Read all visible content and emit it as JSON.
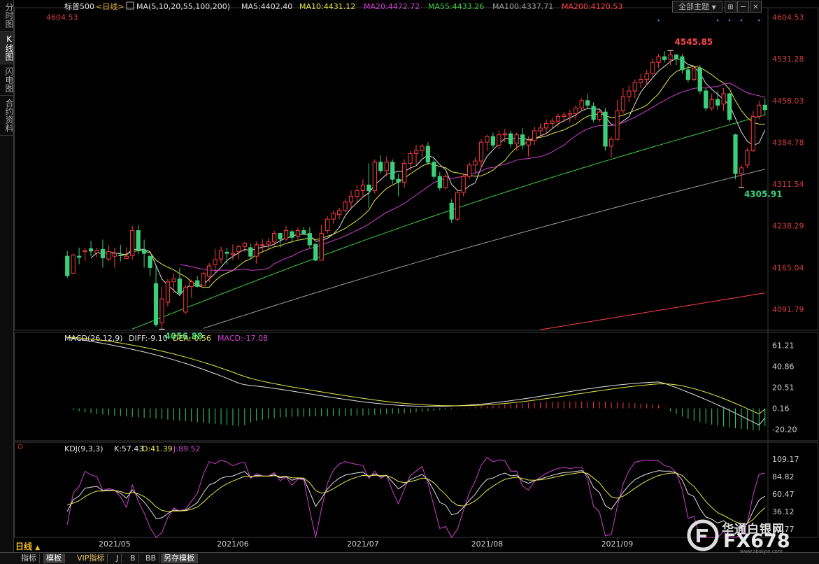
{
  "sidebar": {
    "tabs": [
      {
        "label": "分时图",
        "active": false
      },
      {
        "label": "K线图",
        "active": true
      },
      {
        "label": "闪电图",
        "active": false
      },
      {
        "label": "合约资料",
        "active": false
      }
    ]
  },
  "header": {
    "symbol": "标普500",
    "period_tag": "<日线>",
    "ma_params": "MA(5,10,20,55,100,200)",
    "ma_values": [
      {
        "label": "MA5:4402.40",
        "color": "#e0e0e0"
      },
      {
        "label": "MA10:4431.12",
        "color": "#e6e64a"
      },
      {
        "label": "MA20:4472.72",
        "color": "#d040d0"
      },
      {
        "label": "MA55:4433.26",
        "color": "#40d040"
      },
      {
        "label": "MA100:4337.71",
        "color": "#a0a0a0"
      },
      {
        "label": "MA200:4120.53",
        "color": "#ff4040"
      }
    ],
    "theme_select": "全部主题",
    "theme_caret": "▼"
  },
  "macd": {
    "params": "MACD(26,12,9)",
    "diff": "DIFF:-9.10",
    "dea": "DEA:-0.56",
    "macd": "MACD:-17.08"
  },
  "kdj": {
    "params": "KDJ(9,3,3)",
    "k": "K:57.43",
    "d": "D:41.39",
    "j": "J:89.52"
  },
  "axes": {
    "price_ticks": [
      "4604.53",
      "4531.28",
      "4458.03",
      "4384.78",
      "4311.54",
      "4238.29",
      "4165.04",
      "4091.79"
    ],
    "macd_ticks": [
      "61.21",
      "40.86",
      "20.51",
      "0.16",
      "-20.20"
    ],
    "kdj_ticks": [
      "109.17",
      "84.82",
      "60.47",
      "36.12",
      "11.77"
    ],
    "date_labels": [
      "2021/05",
      "2021/06",
      "2021/07",
      "2021/08",
      "2021/09"
    ]
  },
  "annotations": {
    "high": "4545.85",
    "low_may": "4056.88",
    "low_sep": "4305.91"
  },
  "bottom": {
    "period": "日线",
    "period_arrow": "▲",
    "tabs": [
      {
        "label": "指标",
        "active": false,
        "vip": false
      },
      {
        "label": "模板",
        "active": true,
        "vip": false
      },
      {
        "label": "VIP指标",
        "active": false,
        "vip": true
      },
      {
        "label": "J",
        "active": false,
        "vip": false
      },
      {
        "label": "B",
        "active": false,
        "vip": false
      },
      {
        "label": "BB",
        "active": false,
        "vip": false
      },
      {
        "label": "另存模板",
        "active": true,
        "vip": false
      }
    ]
  },
  "watermark": {
    "cn": "华通白银网",
    "en": "FX678",
    "url": "www.sbaiyin.com"
  },
  "colors": {
    "up": "#ff3c3c",
    "down": "#3ad07a",
    "ma5": "#e0e0e0",
    "ma10": "#e6e64a",
    "ma20": "#d040d0",
    "ma55": "#40d040",
    "ma100": "#a0a0a0",
    "ma200": "#ff4040"
  },
  "chart_data": {
    "type": "candlestick",
    "title": "标普500",
    "y_range": [
      4055,
      4610
    ],
    "candles": [
      {
        "date": "2021/04/26",
        "o": 4185,
        "h": 4194,
        "l": 4147,
        "c": 4151
      },
      {
        "date": "2021/04/27",
        "o": 4155,
        "h": 4190,
        "l": 4154,
        "c": 4187
      },
      {
        "date": "2021/04/28",
        "o": 4185,
        "h": 4200,
        "l": 4171,
        "c": 4183
      },
      {
        "date": "2021/04/29",
        "o": 4193,
        "h": 4200,
        "l": 4177,
        "c": 4195
      },
      {
        "date": "2021/04/30",
        "o": 4198,
        "h": 4212,
        "l": 4185,
        "c": 4194
      },
      {
        "date": "2021/05/03",
        "o": 4191,
        "h": 4200,
        "l": 4183,
        "c": 4195
      },
      {
        "date": "2021/05/04",
        "o": 4197,
        "h": 4214,
        "l": 4165,
        "c": 4182
      },
      {
        "date": "2021/05/05",
        "o": 4180,
        "h": 4204,
        "l": 4176,
        "c": 4193
      },
      {
        "date": "2021/05/06",
        "o": 4185,
        "h": 4200,
        "l": 4165,
        "c": 4190
      },
      {
        "date": "2021/05/07",
        "o": 4187,
        "h": 4205,
        "l": 4176,
        "c": 4186
      },
      {
        "date": "2021/05/10",
        "o": 4181,
        "h": 4200,
        "l": 4180,
        "c": 4185
      },
      {
        "date": "2021/05/11",
        "o": 4186,
        "h": 4238,
        "l": 4179,
        "c": 4230
      },
      {
        "date": "2021/05/12",
        "o": 4230,
        "h": 4240,
        "l": 4189,
        "c": 4195
      },
      {
        "date": "2021/05/13",
        "o": 4196,
        "h": 4214,
        "l": 4165,
        "c": 4190
      },
      {
        "date": "2021/05/14",
        "o": 4185,
        "h": 4182,
        "l": 4150,
        "c": 4165
      },
      {
        "date": "2021/05/17",
        "o": 4137,
        "h": 4168,
        "l": 4061,
        "c": 4065
      },
      {
        "date": "2021/05/18",
        "o": 4068,
        "h": 4131,
        "l": 4057,
        "c": 4110
      },
      {
        "date": "2021/05/19",
        "o": 4104,
        "h": 4145,
        "l": 4097,
        "c": 4140
      },
      {
        "date": "2021/05/20",
        "o": 4140,
        "h": 4155,
        "l": 4120,
        "c": 4145
      },
      {
        "date": "2021/05/21",
        "o": 4145,
        "h": 4164,
        "l": 4118,
        "c": 4120
      },
      {
        "date": "2021/05/24",
        "o": 4087,
        "h": 4135,
        "l": 4084,
        "c": 4130
      },
      {
        "date": "2021/05/25",
        "o": 4132,
        "h": 4144,
        "l": 4112,
        "c": 4140
      },
      {
        "date": "2021/05/26",
        "o": 4142,
        "h": 4150,
        "l": 4130,
        "c": 4132
      },
      {
        "date": "2021/05/27",
        "o": 4133,
        "h": 4158,
        "l": 4132,
        "c": 4155
      },
      {
        "date": "2021/05/28",
        "o": 4150,
        "h": 4173,
        "l": 4140,
        "c": 4168
      },
      {
        "date": "2021/06/01",
        "o": 4170,
        "h": 4198,
        "l": 4154,
        "c": 4179
      },
      {
        "date": "2021/06/02",
        "o": 4180,
        "h": 4202,
        "l": 4172,
        "c": 4195
      },
      {
        "date": "2021/06/03",
        "o": 4192,
        "h": 4200,
        "l": 4170,
        "c": 4190
      },
      {
        "date": "2021/06/04",
        "o": 4188,
        "h": 4206,
        "l": 4178,
        "c": 4190
      },
      {
        "date": "2021/06/07",
        "o": 4193,
        "h": 4205,
        "l": 4180,
        "c": 4202
      },
      {
        "date": "2021/06/08",
        "o": 4202,
        "h": 4210,
        "l": 4193,
        "c": 4208
      },
      {
        "date": "2021/06/09",
        "o": 4200,
        "h": 4207,
        "l": 4180,
        "c": 4185
      },
      {
        "date": "2021/06/10",
        "o": 4185,
        "h": 4211,
        "l": 4172,
        "c": 4205
      },
      {
        "date": "2021/06/11",
        "o": 4205,
        "h": 4215,
        "l": 4193,
        "c": 4205
      },
      {
        "date": "2021/06/14",
        "o": 4206,
        "h": 4217,
        "l": 4197,
        "c": 4210
      },
      {
        "date": "2021/06/15",
        "o": 4210,
        "h": 4230,
        "l": 4203,
        "c": 4225
      },
      {
        "date": "2021/06/16",
        "o": 4225,
        "h": 4226,
        "l": 4200,
        "c": 4215
      },
      {
        "date": "2021/06/17",
        "o": 4215,
        "h": 4238,
        "l": 4212,
        "c": 4230
      },
      {
        "date": "2021/06/18",
        "o": 4228,
        "h": 4232,
        "l": 4208,
        "c": 4218
      },
      {
        "date": "2021/06/21",
        "o": 4220,
        "h": 4235,
        "l": 4215,
        "c": 4230
      },
      {
        "date": "2021/06/22",
        "o": 4230,
        "h": 4236,
        "l": 4222,
        "c": 4225
      },
      {
        "date": "2021/06/23",
        "o": 4225,
        "h": 4236,
        "l": 4200,
        "c": 4205
      },
      {
        "date": "2021/06/24",
        "o": 4206,
        "h": 4208,
        "l": 4176,
        "c": 4178
      },
      {
        "date": "2021/06/25",
        "o": 4178,
        "h": 4240,
        "l": 4177,
        "c": 4225
      },
      {
        "date": "2021/06/28",
        "o": 4230,
        "h": 4255,
        "l": 4225,
        "c": 4250
      },
      {
        "date": "2021/06/29",
        "o": 4250,
        "h": 4265,
        "l": 4242,
        "c": 4260
      },
      {
        "date": "2021/06/30",
        "o": 4258,
        "h": 4270,
        "l": 4250,
        "c": 4265
      },
      {
        "date": "2021/07/01",
        "o": 4265,
        "h": 4285,
        "l": 4262,
        "c": 4280
      },
      {
        "date": "2021/07/02",
        "o": 4280,
        "h": 4300,
        "l": 4270,
        "c": 4290
      },
      {
        "date": "2021/07/06",
        "o": 4290,
        "h": 4310,
        "l": 4280,
        "c": 4300
      },
      {
        "date": "2021/07/07",
        "o": 4300,
        "h": 4320,
        "l": 4288,
        "c": 4310
      },
      {
        "date": "2021/07/08",
        "o": 4310,
        "h": 4348,
        "l": 4270,
        "c": 4300
      },
      {
        "date": "2021/07/09",
        "o": 4300,
        "h": 4355,
        "l": 4295,
        "c": 4350
      },
      {
        "date": "2021/07/12",
        "o": 4350,
        "h": 4362,
        "l": 4330,
        "c": 4335
      },
      {
        "date": "2021/07/13",
        "o": 4335,
        "h": 4360,
        "l": 4325,
        "c": 4350
      },
      {
        "date": "2021/07/14",
        "o": 4350,
        "h": 4355,
        "l": 4312,
        "c": 4320
      },
      {
        "date": "2021/07/15",
        "o": 4320,
        "h": 4330,
        "l": 4290,
        "c": 4315
      },
      {
        "date": "2021/07/16",
        "o": 4315,
        "h": 4355,
        "l": 4305,
        "c": 4348
      },
      {
        "date": "2021/07/19",
        "o": 4348,
        "h": 4370,
        "l": 4335,
        "c": 4365
      },
      {
        "date": "2021/07/20",
        "o": 4365,
        "h": 4380,
        "l": 4345,
        "c": 4370
      },
      {
        "date": "2021/07/21",
        "o": 4370,
        "h": 4382,
        "l": 4358,
        "c": 4378
      },
      {
        "date": "2021/07/22",
        "o": 4378,
        "h": 4385,
        "l": 4345,
        "c": 4350
      },
      {
        "date": "2021/07/23",
        "o": 4350,
        "h": 4360,
        "l": 4320,
        "c": 4325
      },
      {
        "date": "2021/07/26",
        "o": 4325,
        "h": 4333,
        "l": 4300,
        "c": 4305
      },
      {
        "date": "2021/07/27",
        "o": 4305,
        "h": 4330,
        "l": 4302,
        "c": 4325
      },
      {
        "date": "2021/07/28",
        "o": 4278,
        "h": 4285,
        "l": 4243,
        "c": 4250
      },
      {
        "date": "2021/07/29",
        "o": 4250,
        "h": 4300,
        "l": 4247,
        "c": 4297
      },
      {
        "date": "2021/07/30",
        "o": 4297,
        "h": 4330,
        "l": 4290,
        "c": 4325
      },
      {
        "date": "2021/08/02",
        "o": 4325,
        "h": 4350,
        "l": 4320,
        "c": 4345
      },
      {
        "date": "2021/08/03",
        "o": 4345,
        "h": 4358,
        "l": 4330,
        "c": 4352
      },
      {
        "date": "2021/08/04",
        "o": 4352,
        "h": 4390,
        "l": 4340,
        "c": 4385
      },
      {
        "date": "2021/08/05",
        "o": 4385,
        "h": 4398,
        "l": 4370,
        "c": 4395
      },
      {
        "date": "2021/08/06",
        "o": 4395,
        "h": 4402,
        "l": 4375,
        "c": 4380
      },
      {
        "date": "2021/08/09",
        "o": 4380,
        "h": 4405,
        "l": 4372,
        "c": 4398
      },
      {
        "date": "2021/08/10",
        "o": 4398,
        "h": 4408,
        "l": 4385,
        "c": 4400
      },
      {
        "date": "2021/08/11",
        "o": 4400,
        "h": 4405,
        "l": 4375,
        "c": 4382
      },
      {
        "date": "2021/08/12",
        "o": 4382,
        "h": 4402,
        "l": 4370,
        "c": 4398
      },
      {
        "date": "2021/08/13",
        "o": 4398,
        "h": 4410,
        "l": 4372,
        "c": 4380
      },
      {
        "date": "2021/08/16",
        "o": 4380,
        "h": 4395,
        "l": 4360,
        "c": 4388
      },
      {
        "date": "2021/08/17",
        "o": 4388,
        "h": 4412,
        "l": 4380,
        "c": 4405
      },
      {
        "date": "2021/08/18",
        "o": 4405,
        "h": 4418,
        "l": 4395,
        "c": 4410
      },
      {
        "date": "2021/08/19",
        "o": 4410,
        "h": 4425,
        "l": 4400,
        "c": 4418
      },
      {
        "date": "2021/08/20",
        "o": 4418,
        "h": 4428,
        "l": 4408,
        "c": 4422
      },
      {
        "date": "2021/08/23",
        "o": 4422,
        "h": 4435,
        "l": 4412,
        "c": 4430
      },
      {
        "date": "2021/08/24",
        "o": 4430,
        "h": 4438,
        "l": 4420,
        "c": 4433
      },
      {
        "date": "2021/08/25",
        "o": 4433,
        "h": 4442,
        "l": 4420,
        "c": 4435
      },
      {
        "date": "2021/08/26",
        "o": 4435,
        "h": 4450,
        "l": 4425,
        "c": 4445
      },
      {
        "date": "2021/08/27",
        "o": 4445,
        "h": 4462,
        "l": 4440,
        "c": 4458
      },
      {
        "date": "2021/08/30",
        "o": 4458,
        "h": 4470,
        "l": 4445,
        "c": 4450
      },
      {
        "date": "2021/08/31",
        "o": 4448,
        "h": 4455,
        "l": 4420,
        "c": 4425
      },
      {
        "date": "2021/09/01",
        "o": 4425,
        "h": 4442,
        "l": 4420,
        "c": 4438
      },
      {
        "date": "2021/09/02",
        "o": 4438,
        "h": 4445,
        "l": 4370,
        "c": 4378
      },
      {
        "date": "2021/09/03",
        "o": 4378,
        "h": 4395,
        "l": 4358,
        "c": 4390
      },
      {
        "date": "2021/09/07",
        "o": 4390,
        "h": 4460,
        "l": 4388,
        "c": 4440
      },
      {
        "date": "2021/09/08",
        "o": 4440,
        "h": 4480,
        "l": 4435,
        "c": 4465
      },
      {
        "date": "2021/09/09",
        "o": 4465,
        "h": 4485,
        "l": 4455,
        "c": 4475
      },
      {
        "date": "2021/09/10",
        "o": 4475,
        "h": 4495,
        "l": 4462,
        "c": 4490
      },
      {
        "date": "2021/09/13",
        "o": 4490,
        "h": 4505,
        "l": 4480,
        "c": 4495
      },
      {
        "date": "2021/09/14",
        "o": 4495,
        "h": 4512,
        "l": 4485,
        "c": 4505
      },
      {
        "date": "2021/09/15",
        "o": 4505,
        "h": 4532,
        "l": 4500,
        "c": 4525
      },
      {
        "date": "2021/09/16",
        "o": 4525,
        "h": 4540,
        "l": 4515,
        "c": 4535
      },
      {
        "date": "2021/09/17",
        "o": 4535,
        "h": 4545,
        "l": 4525,
        "c": 4530
      },
      {
        "date": "2021/09/20",
        "o": 4530,
        "h": 4545.85,
        "l": 4520,
        "c": 4538
      },
      {
        "date": "2021/09/21",
        "o": 4538,
        "h": 4540,
        "l": 4520,
        "c": 4532
      },
      {
        "date": "2021/09/22",
        "o": 4535,
        "h": 4540,
        "l": 4505,
        "c": 4512
      },
      {
        "date": "2021/09/23",
        "o": 4512,
        "h": 4520,
        "l": 4490,
        "c": 4495
      },
      {
        "date": "2021/09/24",
        "o": 4495,
        "h": 4518,
        "l": 4492,
        "c": 4515
      },
      {
        "date": "2021/09/27",
        "o": 4515,
        "h": 4520,
        "l": 4470,
        "c": 4475
      },
      {
        "date": "2021/09/28",
        "o": 4475,
        "h": 4480,
        "l": 4440,
        "c": 4445
      },
      {
        "date": "2021/09/29",
        "o": 4445,
        "h": 4470,
        "l": 4440,
        "c": 4460
      },
      {
        "date": "2021/09/30",
        "o": 4460,
        "h": 4475,
        "l": 4442,
        "c": 4450
      },
      {
        "date": "2021/10/01",
        "o": 4452,
        "h": 4480,
        "l": 4440,
        "c": 4470
      },
      {
        "date": "2021/10/04",
        "o": 4470,
        "h": 4472,
        "l": 4420,
        "c": 4425
      },
      {
        "date": "2021/10/05",
        "o": 4398,
        "h": 4400,
        "l": 4320,
        "c": 4330
      },
      {
        "date": "2021/10/06",
        "o": 4330,
        "h": 4345,
        "l": 4305.91,
        "c": 4340
      },
      {
        "date": "2021/10/07",
        "o": 4345,
        "h": 4375,
        "l": 4340,
        "c": 4370
      },
      {
        "date": "2021/10/08",
        "o": 4370,
        "h": 4440,
        "l": 4368,
        "c": 4430
      },
      {
        "date": "2021/10/11",
        "o": 4430,
        "h": 4458,
        "l": 4425,
        "c": 4450
      },
      {
        "date": "2021/10/12",
        "o": 4450,
        "h": 4462,
        "l": 4432,
        "c": 4442
      }
    ],
    "moving_averages": [
      {
        "name": "MA5",
        "value": 4402.4
      },
      {
        "name": "MA10",
        "value": 4431.12
      },
      {
        "name": "MA20",
        "value": 4472.72
      },
      {
        "name": "MA55",
        "value": 4433.26
      },
      {
        "name": "MA100",
        "value": 4337.71
      },
      {
        "name": "MA200",
        "value": 4120.53
      }
    ],
    "macd": {
      "params": "26,12,9",
      "diff": -9.1,
      "dea": -0.56,
      "macd": -17.08,
      "y_range": [
        -30,
        65
      ]
    },
    "kdj": {
      "params": "9,3,3",
      "k": 57.43,
      "d": 41.39,
      "j": 89.52,
      "y_range": [
        0,
        115
      ]
    }
  }
}
